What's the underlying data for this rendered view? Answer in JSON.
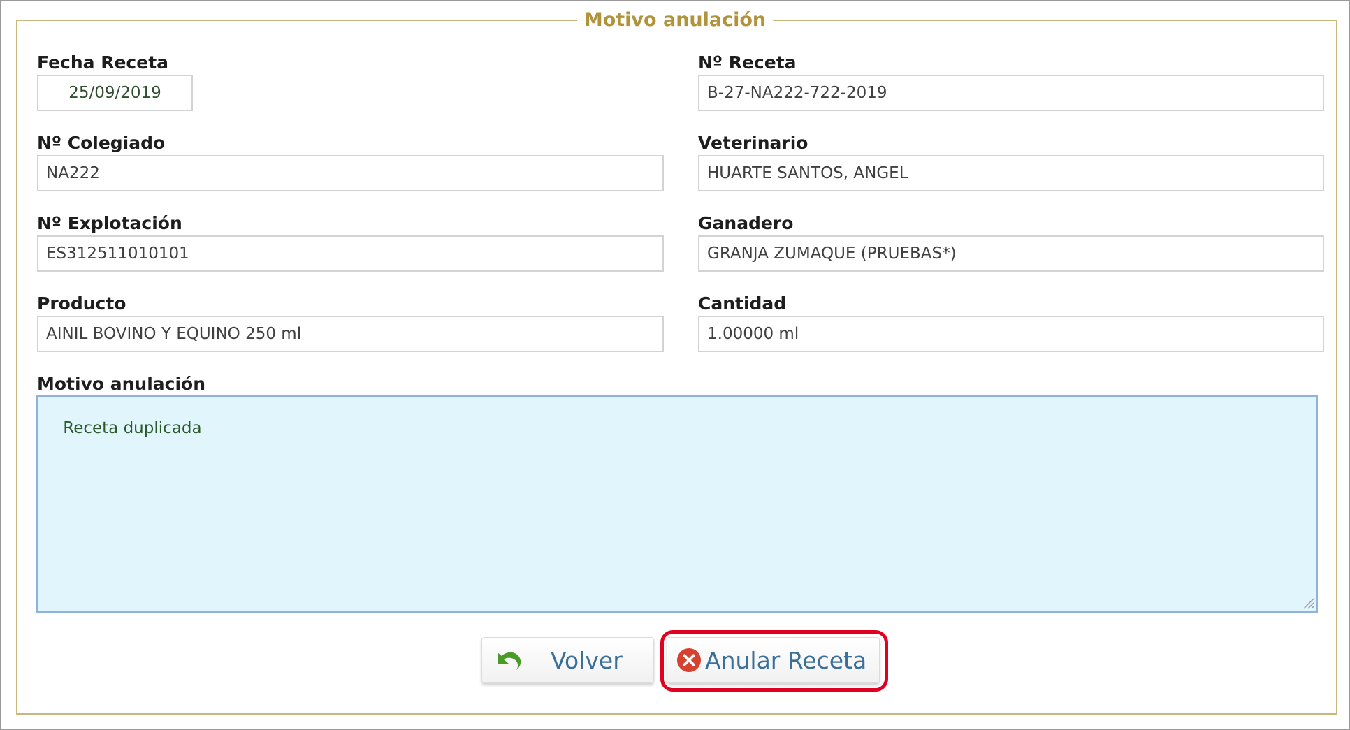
{
  "legend": "Motivo anulación",
  "fields": {
    "fecha_receta": {
      "label": "Fecha Receta",
      "value": "25/09/2019"
    },
    "n_receta": {
      "label": "Nº Receta",
      "value": "B-27-NA222-722-2019"
    },
    "n_colegiado": {
      "label": "Nº Colegiado",
      "value": "NA222"
    },
    "veterinario": {
      "label": "Veterinario",
      "value": "HUARTE SANTOS, ANGEL"
    },
    "n_explotacion": {
      "label": "Nº Explotación",
      "value": "ES312511010101"
    },
    "ganadero": {
      "label": "Ganadero",
      "value": "GRANJA ZUMAQUE (PRUEBAS*)"
    },
    "producto": {
      "label": "Producto",
      "value": "AINIL BOVINO Y EQUINO  250 ml"
    },
    "cantidad": {
      "label": "Cantidad",
      "value": "1.00000 ml"
    }
  },
  "motivo": {
    "label": "Motivo anulación",
    "value": "Receta duplicada"
  },
  "buttons": {
    "volver": {
      "label": "Volver",
      "icon": "undo-arrow-icon"
    },
    "anular": {
      "label": "Anular Receta",
      "icon": "cancel-circle-icon"
    }
  },
  "colors": {
    "legend": "#b0933a",
    "fieldset_border": "#cbb77e",
    "textarea_bg": "#e1f5fc",
    "button_text": "#3a6f9a",
    "highlight": "#e00020",
    "undo_icon": "#4a9a2a",
    "cancel_icon": "#d84030"
  }
}
